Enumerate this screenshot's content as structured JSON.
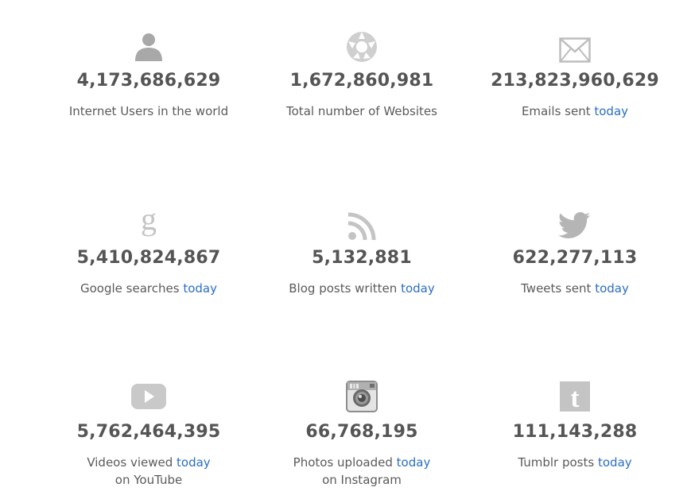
{
  "stats": [
    {
      "number": "4,173,686,629",
      "label": "Internet Users in the world",
      "icon": "user-icon",
      "today": "",
      "suffix": ""
    },
    {
      "number": "1,672,860,981",
      "label": "Total number of Websites",
      "icon": "globe-icon",
      "today": "",
      "suffix": ""
    },
    {
      "number": "213,823,960,629",
      "label": "Emails sent",
      "icon": "envelope-icon",
      "today": "today",
      "suffix": ""
    },
    {
      "number": "5,410,824,867",
      "label": "Google searches",
      "icon": "google-icon",
      "today": "today",
      "suffix": ""
    },
    {
      "number": "5,132,881",
      "label": "Blog posts written",
      "icon": "rss-icon",
      "today": "today",
      "suffix": ""
    },
    {
      "number": "622,277,113",
      "label": "Tweets sent",
      "icon": "twitter-bird-icon",
      "today": "today",
      "suffix": ""
    },
    {
      "number": "5,762,464,395",
      "label": "Videos viewed",
      "icon": "youtube-play-icon",
      "today": "today",
      "suffix": "on YouTube"
    },
    {
      "number": "66,768,195",
      "label": "Photos uploaded",
      "icon": "instagram-camera-icon",
      "today": "today",
      "suffix": "on Instagram"
    },
    {
      "number": "111,143,288",
      "label": "Tumblr posts",
      "icon": "tumblr-icon",
      "today": "today",
      "suffix": ""
    }
  ],
  "colors": {
    "text": "#555555",
    "icon": "#c4c4c4",
    "accent": "#2a6ec2"
  }
}
